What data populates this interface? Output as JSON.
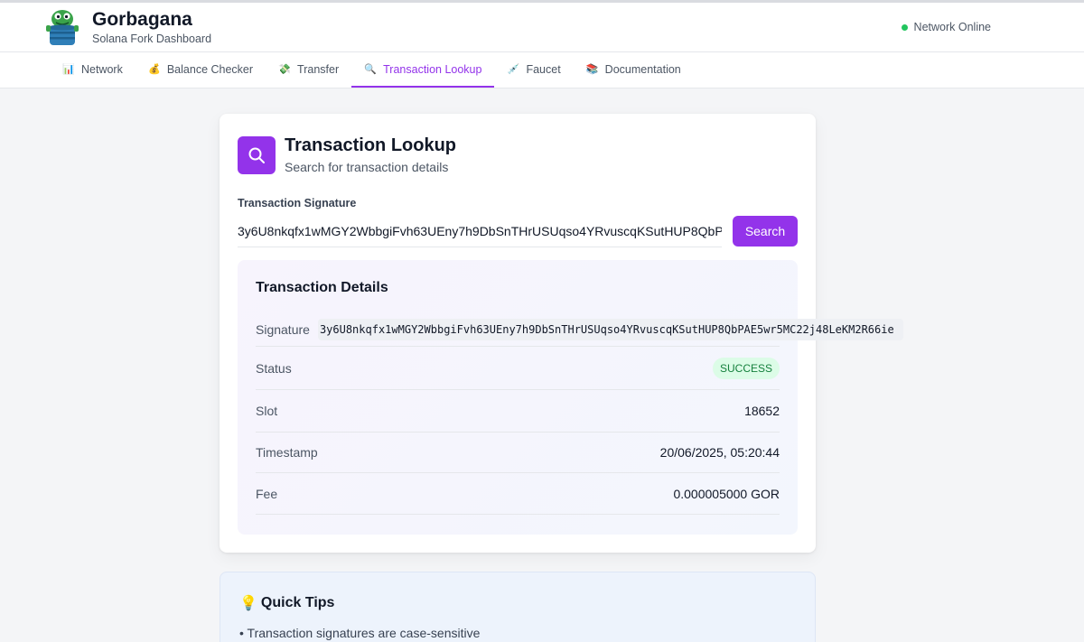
{
  "app": {
    "title": "Gorbagana",
    "subtitle": "Solana Fork Dashboard",
    "status": "Network Online",
    "status_color": "#22c55e",
    "accent": "#9333ea"
  },
  "tabs": [
    {
      "label": "Network",
      "icon": "chart-icon",
      "active": false
    },
    {
      "label": "Balance Checker",
      "icon": "money-bag-icon",
      "active": false
    },
    {
      "label": "Transfer",
      "icon": "money-wings-icon",
      "active": false
    },
    {
      "label": "Transaction Lookup",
      "icon": "magnifier-icon",
      "active": true
    },
    {
      "label": "Faucet",
      "icon": "syringe-icon",
      "active": false
    },
    {
      "label": "Documentation",
      "icon": "books-icon",
      "active": false
    }
  ],
  "lookup": {
    "title": "Transaction Lookup",
    "subtitle": "Search for transaction details",
    "field_label": "Transaction Signature",
    "input_value": "3y6U8nkqfx1wMGY2WbbgiFvh63UEny7h9DbSnTHrUSUqso4YRvuscqKSutHUP8QbP.",
    "search_label": "Search"
  },
  "details": {
    "title": "Transaction Details",
    "signature_label": "Signature",
    "signature_value": "3y6U8nkqfx1wMGY2WbbgiFvh63UEny7h9DbSnTHrUSUqso4YRvuscqKSutHUP8QbPAE5wr5MC22j48LeKM2R66ie",
    "status_label": "Status",
    "status_value": "SUCCESS",
    "slot_label": "Slot",
    "slot_value": "18652",
    "timestamp_label": "Timestamp",
    "timestamp_value": "20/06/2025, 05:20:44",
    "fee_label": "Fee",
    "fee_value": "0.000005000 GOR"
  },
  "tips": {
    "title": "Quick Tips",
    "icon": "lightbulb-icon",
    "items": [
      "Transaction signatures are case-sensitive"
    ]
  }
}
